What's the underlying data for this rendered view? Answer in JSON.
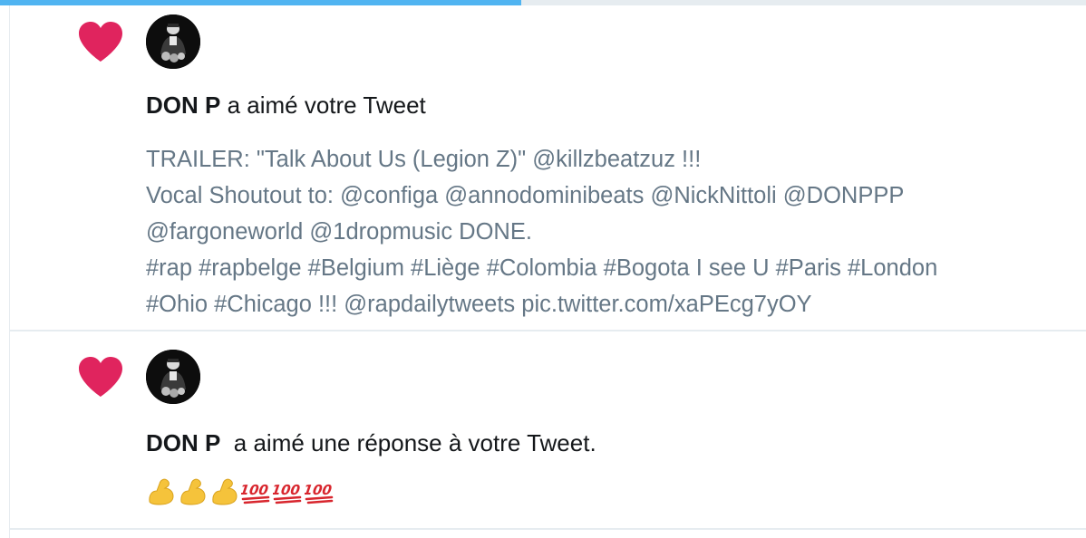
{
  "top_progress": {
    "fraction": 0.48
  },
  "colors": {
    "heart": "#e0245e",
    "text_primary": "#14171a",
    "text_secondary": "#657786",
    "divider": "#e6ecf0",
    "progress": "#1da1f2",
    "emoji_muscle": "#f5c33b",
    "emoji_hundred": "#d8262e"
  },
  "notifications": [
    {
      "icon": "heart-icon",
      "avatar": "user-avatar",
      "user_name": "DON P",
      "action": " a aimé votre Tweet",
      "tweet_lines": [
        "TRAILER: \"Talk About Us (Legion Z)\" @killzbeatzuz  !!!",
        "Vocal Shoutout to: @configa @annodominibeats @NickNittoli @DONPPP",
        "@fargoneworld @1dropmusic DONE.",
        "#rap #rapbelge #Belgium #Liège #Colombia #Bogota I see U #Paris #London",
        "#Ohio #Chicago !!! @rapdailytweets pic.twitter.com/xaPEcg7yOY"
      ]
    },
    {
      "icon": "heart-icon",
      "avatar": "user-avatar",
      "user_name": "DON P",
      "action": "  a aimé une réponse à votre Tweet.",
      "emojis": [
        "flexed-biceps-emoji",
        "flexed-biceps-emoji",
        "flexed-biceps-emoji",
        "hundred-points-emoji",
        "hundred-points-emoji",
        "hundred-points-emoji"
      ]
    }
  ]
}
